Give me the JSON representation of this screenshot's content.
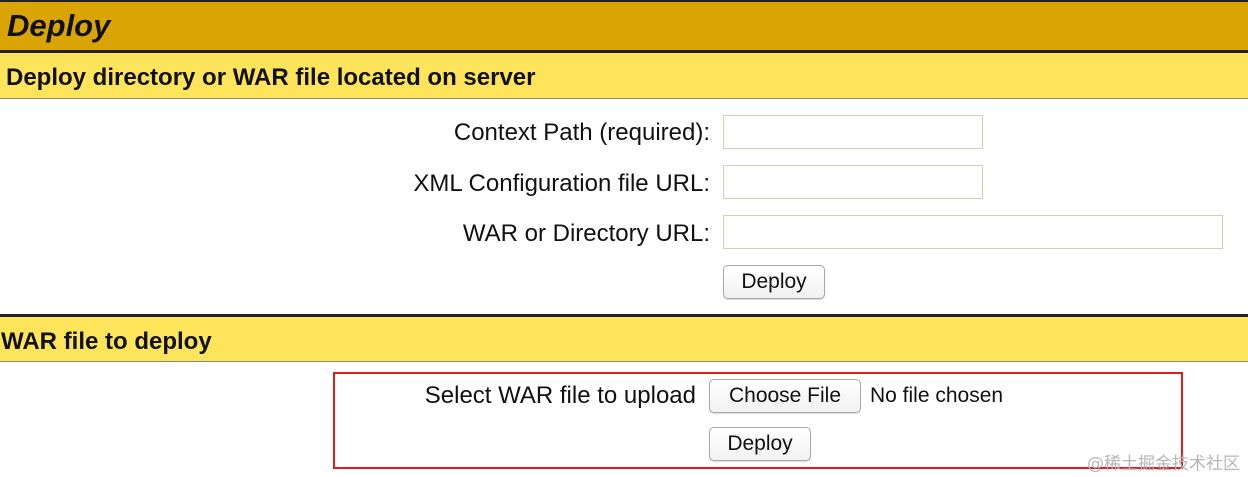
{
  "page": {
    "title": "Deploy"
  },
  "server_section": {
    "header": "Deploy directory or WAR file located on server",
    "context_path_label": "Context Path (required):",
    "context_path_value": "",
    "xml_config_label": "XML Configuration file URL:",
    "xml_config_value": "",
    "war_dir_label": "WAR or Directory URL:",
    "war_dir_value": "",
    "deploy_label": "Deploy"
  },
  "upload_section": {
    "header": "WAR file to deploy",
    "select_label": "Select WAR file to upload",
    "choose_file_label": "Choose File",
    "file_status": "No file chosen",
    "deploy_label": "Deploy"
  },
  "watermark": "@稀土掘金技术社区",
  "colors": {
    "title_bar": "#d9a404",
    "section_header": "#fde45a",
    "highlight_border": "#e8171b"
  }
}
